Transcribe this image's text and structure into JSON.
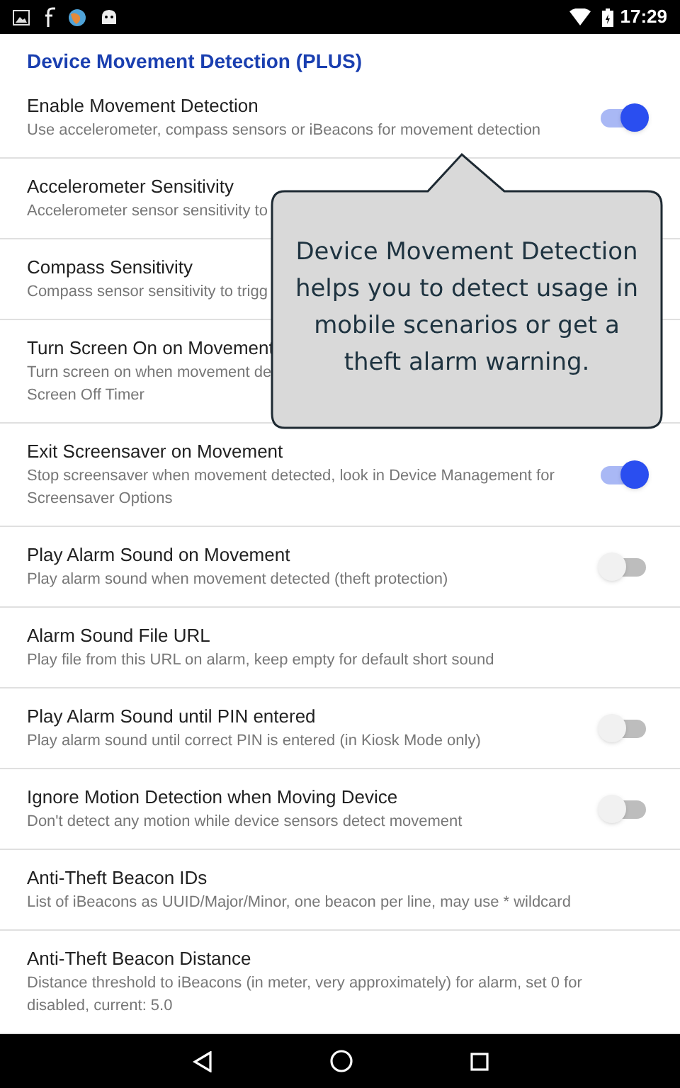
{
  "status_bar": {
    "time": "17:29"
  },
  "section_title": "Device Movement Detection (PLUS)",
  "settings": [
    {
      "kind": "switch",
      "title": "Enable Movement Detection",
      "summary": "Use accelerometer, compass sensors or iBeacons for movement detection",
      "on": true
    },
    {
      "kind": "text",
      "title": "Accelerometer Sensitivity",
      "summary": "Accelerometer sensor sensitivity to"
    },
    {
      "kind": "text",
      "title": "Compass Sensitivity",
      "summary": "Compass sensor sensitivity to trigg"
    },
    {
      "kind": "text",
      "title": "Turn Screen On on Movement",
      "summary": "Turn screen on when movement de",
      "summary_2": "Screen Off Timer"
    },
    {
      "kind": "switch",
      "title": "Exit Screensaver on Movement",
      "summary": "Stop screensaver when movement detected, look in Device Management for Screensaver Options",
      "on": true
    },
    {
      "kind": "switch",
      "title": "Play Alarm Sound on Movement",
      "summary": "Play alarm sound when movement detected (theft protection)",
      "on": false
    },
    {
      "kind": "text",
      "title": "Alarm Sound File URL",
      "summary": "Play file from this URL on alarm, keep empty for default short sound"
    },
    {
      "kind": "switch",
      "title": "Play Alarm Sound until PIN entered",
      "summary": "Play alarm sound until correct PIN is entered (in Kiosk Mode only)",
      "on": false
    },
    {
      "kind": "switch",
      "title": "Ignore Motion Detection when Moving Device",
      "summary": "Don't detect any motion while device sensors detect movement",
      "on": false
    },
    {
      "kind": "text",
      "title": "Anti-Theft Beacon IDs",
      "summary": "List of iBeacons as UUID/Major/Minor, one beacon per line, may use * wildcard"
    },
    {
      "kind": "text",
      "title": "Anti-Theft Beacon Distance",
      "summary": "Distance threshold to iBeacons (in meter, very approximately) for alarm, set 0 for disabled, current: 5.0"
    }
  ],
  "tooltip": {
    "text": "Device Movement Detection helps you to detect usage in mobile scenarios or get a theft alarm warning."
  }
}
